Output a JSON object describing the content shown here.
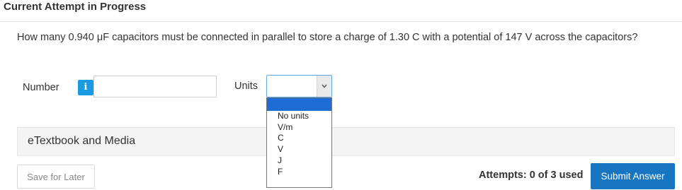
{
  "header": {
    "title": "Current Attempt in Progress"
  },
  "question": {
    "text": "How many 0.940 μF capacitors must be connected in parallel to store a charge of 1.30 C with a potential of 147 V across the capacitors?"
  },
  "answer": {
    "number_label": "Number",
    "info_icon": "i",
    "number_value": "",
    "units_label": "Units",
    "units_selected": "",
    "unit_options": [
      "No units",
      "V/m",
      "C",
      "V",
      "J",
      "F"
    ]
  },
  "etextbook": {
    "label": "eTextbook and Media"
  },
  "footer": {
    "save_label": "Save for Later",
    "attempts_text": "Attempts: 0 of 3 used",
    "submit_label": "Submit Answer"
  },
  "colors": {
    "accent": "#1775c2",
    "info": "#1a9ae0",
    "dropdown_highlight": "#1e6cd6"
  }
}
